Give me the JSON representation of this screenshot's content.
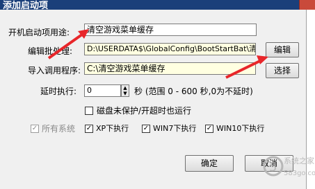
{
  "window": {
    "title": "添加启动项"
  },
  "form": {
    "startup_name_label": "开机启动项用途:",
    "startup_name_value": "清空游戏菜单缓存",
    "batch_label": "编辑批处理:",
    "batch_value": "D:\\USERDATA$\\GlobalConfig\\BootStartBat\\清",
    "edit_label": "编辑",
    "import_label": "导入调用程序:",
    "import_value": "C:\\清空游戏菜单缓存",
    "browse_label": "选择",
    "delay_label": "延时执行:",
    "delay_value": "0",
    "delay_unit": "秒 (范围 0 - 600 秒,0为不延时)",
    "disk_protect_label": "磁盘未保护/开超时也运行",
    "all_systems_label": "所有系统",
    "xp_label": "XP下执行",
    "win7_label": "WIN7下执行",
    "win10_label": "WIN10下执行",
    "ok_label": "确定",
    "cancel_label": "取消"
  },
  "watermark": {
    "brand_top": "系统之家",
    "brand_bottom": "583go.com"
  },
  "colors": {
    "arrow": "#e8262a",
    "titlebar": "#1a3f7a"
  }
}
